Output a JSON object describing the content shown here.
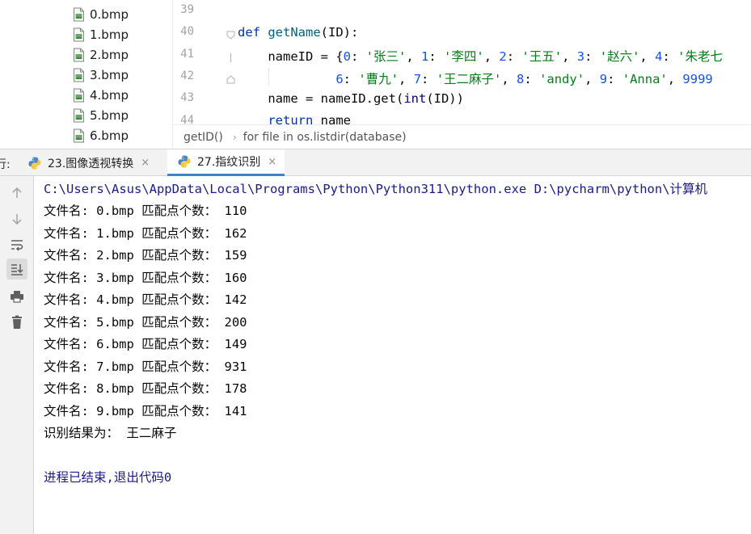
{
  "project_tree": {
    "files": [
      {
        "name": "0.bmp"
      },
      {
        "name": "1.bmp"
      },
      {
        "name": "2.bmp"
      },
      {
        "name": "3.bmp"
      },
      {
        "name": "4.bmp"
      },
      {
        "name": "5.bmp"
      },
      {
        "name": "6.bmp"
      }
    ],
    "file_icon": "image-file-icon"
  },
  "editor": {
    "line_numbers": [
      "39",
      "40",
      "41",
      "42",
      "43",
      "44"
    ],
    "lines": [
      {
        "kw": "def",
        "fn": "getName",
        "rest": "(ID):"
      },
      {
        "prefix": "nameID = {",
        "pairs": [
          {
            "k": "0",
            "v": "'张三'"
          },
          {
            "k": "1",
            "v": "'李四'"
          },
          {
            "k": "2",
            "v": "'王五'"
          },
          {
            "k": "3",
            "v": "'赵六'"
          },
          {
            "k": "4",
            "v": "'朱老七"
          }
        ]
      },
      {
        "pairs": [
          {
            "k": "6",
            "v": "'曹九'"
          },
          {
            "k": "7",
            "v": "'王二麻子'"
          },
          {
            "k": "8",
            "v": "'andy'"
          },
          {
            "k": "9",
            "v": "'Anna'"
          }
        ],
        "tail": "9999"
      },
      {
        "text_a": "name = nameID.get(",
        "builtin": "int",
        "text_b": "(ID))"
      },
      {
        "kw": "return",
        "rest": " name"
      }
    ]
  },
  "breadcrumb": {
    "items": [
      "getID()",
      "for file in os.listdir(database)"
    ],
    "separator": "›"
  },
  "run_window": {
    "label": "行:",
    "tabs": [
      {
        "label": "23.图像透视转换",
        "close": "×",
        "active": false
      },
      {
        "label": "27.指纹识别",
        "close": "×",
        "active": true
      }
    ]
  },
  "tools": [
    "up-arrow-icon",
    "down-arrow-icon",
    "soft-wrap-icon",
    "scroll-to-end-icon",
    "print-icon",
    "trash-icon"
  ],
  "console": {
    "command": "C:\\Users\\Asus\\AppData\\Local\\Programs\\Python\\Python311\\python.exe D:\\pycharm\\python\\计算机",
    "results": [
      {
        "prefix": "文件名: ",
        "file": "0.bmp",
        "mid": " 匹配点个数： ",
        "count": "110"
      },
      {
        "prefix": "文件名: ",
        "file": "1.bmp",
        "mid": " 匹配点个数： ",
        "count": "162"
      },
      {
        "prefix": "文件名: ",
        "file": "2.bmp",
        "mid": " 匹配点个数： ",
        "count": "159"
      },
      {
        "prefix": "文件名: ",
        "file": "3.bmp",
        "mid": " 匹配点个数： ",
        "count": "160"
      },
      {
        "prefix": "文件名: ",
        "file": "4.bmp",
        "mid": " 匹配点个数： ",
        "count": "142"
      },
      {
        "prefix": "文件名: ",
        "file": "5.bmp",
        "mid": " 匹配点个数： ",
        "count": "200"
      },
      {
        "prefix": "文件名: ",
        "file": "6.bmp",
        "mid": " 匹配点个数： ",
        "count": "149"
      },
      {
        "prefix": "文件名: ",
        "file": "7.bmp",
        "mid": " 匹配点个数： ",
        "count": "931"
      },
      {
        "prefix": "文件名: ",
        "file": "8.bmp",
        "mid": " 匹配点个数： ",
        "count": "178"
      },
      {
        "prefix": "文件名: ",
        "file": "9.bmp",
        "mid": " 匹配点个数： ",
        "count": "141"
      }
    ],
    "result_line": "识别结果为： 王二麻子",
    "exit_line": "进程已结束,退出代码0"
  }
}
